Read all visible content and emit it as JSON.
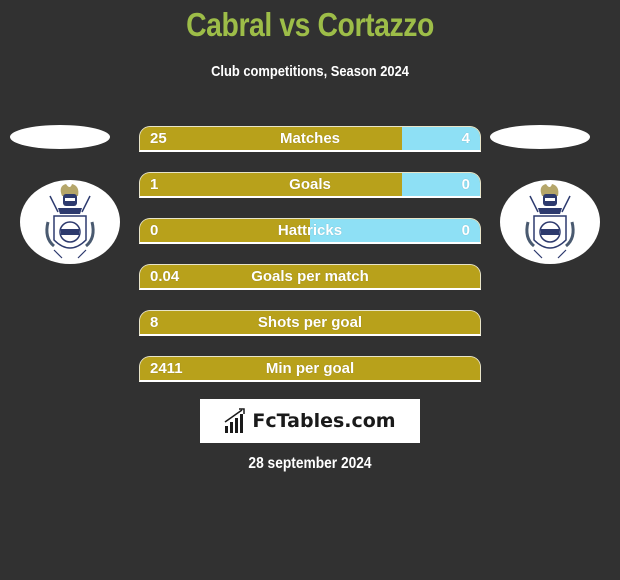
{
  "header": {
    "title": "Cabral vs Cortazzo",
    "subtitle": "Club competitions, Season 2024"
  },
  "players": {
    "left": {
      "name": "Cabral",
      "crest_icon": "club-crest-icon"
    },
    "right": {
      "name": "Cortazzo",
      "crest_icon": "club-crest-icon"
    }
  },
  "colors": {
    "title": "#9dbd48",
    "left_bar": "#b8a11b",
    "right_bar": "#8ee0f5",
    "background": "#313131"
  },
  "stats": [
    {
      "label": "Matches",
      "left": "25",
      "right": "4",
      "left_share": 0.77
    },
    {
      "label": "Goals",
      "left": "1",
      "right": "0",
      "left_share": 0.77
    },
    {
      "label": "Hattricks",
      "left": "0",
      "right": "0",
      "left_share": 0.5
    },
    {
      "label": "Goals per match",
      "left": "0.04",
      "right": "",
      "left_share": 1.0
    },
    {
      "label": "Shots per goal",
      "left": "8",
      "right": "",
      "left_share": 1.0
    },
    {
      "label": "Min per goal",
      "left": "2411",
      "right": "",
      "left_share": 1.0
    }
  ],
  "footer": {
    "logo_text": "FcTables.com",
    "logo_icon": "bar-chart-icon",
    "date": "28 september 2024"
  }
}
